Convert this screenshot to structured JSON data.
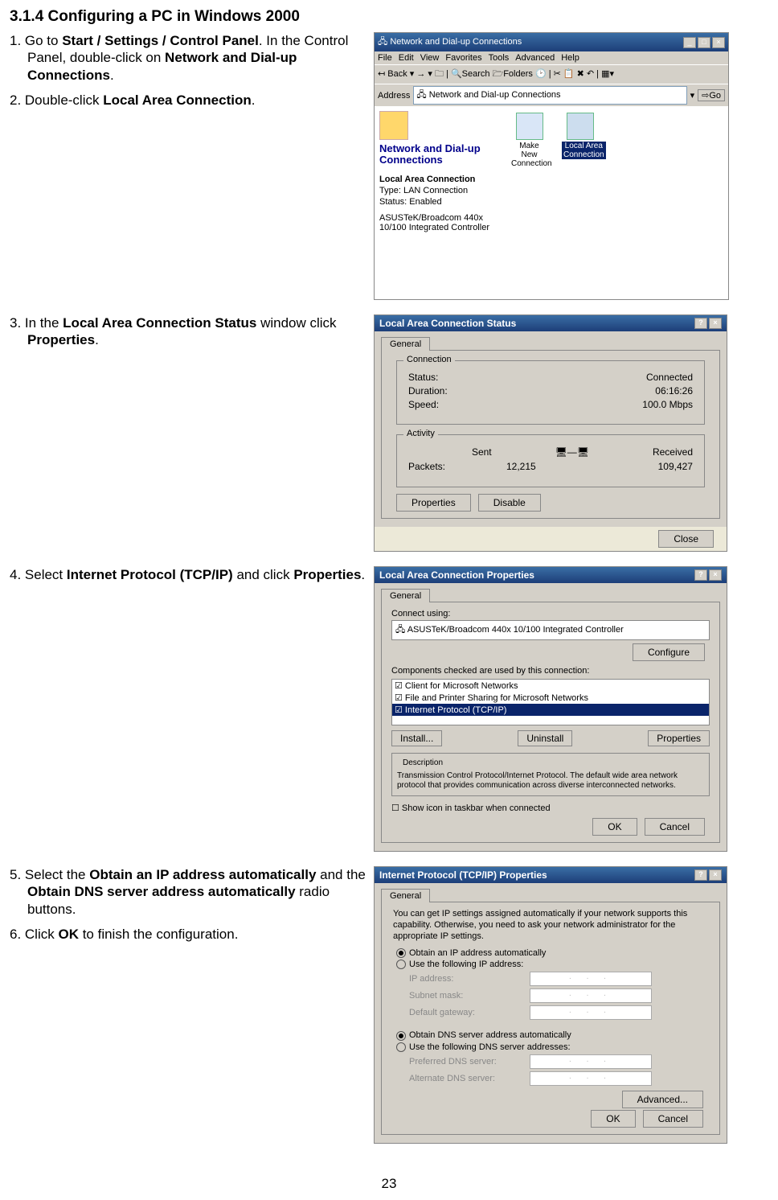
{
  "section_title": "3.1.4 Configuring a PC in Windows 2000",
  "page_number": "23",
  "steps": {
    "s1a": "1. Go to ",
    "s1b": "Start / Settings / Control Panel",
    "s1c": ". In the Control Panel, double-click on ",
    "s1d": "Network and Dial-up Connections",
    "s1e": ".",
    "s2a": "2. Double-click ",
    "s2b": "Local Area Connection",
    "s2c": ".",
    "s3a": "3. In the ",
    "s3b": "Local Area Connection Status",
    "s3c": " window click ",
    "s3d": "Properties",
    "s3e": ".",
    "s4a": "4. Select ",
    "s4b": "Internet Protocol (TCP/IP)",
    "s4c": " and click ",
    "s4d": "Properties",
    "s4e": ".",
    "s5a": "5. Select the ",
    "s5b": "Obtain an IP address automatically",
    "s5c": " and the ",
    "s5d": "Obtain DNS server address automatically",
    "s5e": " radio buttons.",
    "s6a": "6. Click ",
    "s6b": "OK",
    "s6c": " to finish the configuration."
  },
  "win1": {
    "title": "Network and Dial-up Connections",
    "menus": [
      "File",
      "Edit",
      "View",
      "Favorites",
      "Tools",
      "Advanced",
      "Help"
    ],
    "toolbar": "↤ Back ▾  →  ▾  🗀  | 🔍Search  🗁Folders  🕑 | ✂ 📋 ✖ ↶ | ▦▾",
    "address_label": "Address",
    "address_value": "Network and Dial-up Connections",
    "go": "Go",
    "left_title": "Network and Dial-up Connections",
    "lac": "Local Area Connection",
    "type_label": "Type: LAN Connection",
    "status_label": "Status: Enabled",
    "adapter": "ASUSTeK/Broadcom 440x 10/100 Integrated Controller",
    "icon1": "Make New Connection",
    "icon2": "Local Area Connection"
  },
  "win2": {
    "title": "Local Area Connection Status",
    "tab": "General",
    "grp1": "Connection",
    "status_l": "Status:",
    "status_v": "Connected",
    "dur_l": "Duration:",
    "dur_v": "06:16:26",
    "speed_l": "Speed:",
    "speed_v": "100.0 Mbps",
    "grp2": "Activity",
    "sent": "Sent",
    "recv": "Received",
    "packets_l": "Packets:",
    "packets_sent": "12,215",
    "packets_recv": "109,427",
    "btn_props": "Properties",
    "btn_disable": "Disable",
    "btn_close": "Close"
  },
  "win3": {
    "title": "Local Area Connection Properties",
    "tab": "General",
    "connect_using_l": "Connect using:",
    "adapter": "ASUSTeK/Broadcom 440x 10/100 Integrated Controller",
    "configure": "Configure",
    "components_l": "Components checked are used by this connection:",
    "items": [
      "Client for Microsoft Networks",
      "File and Printer Sharing for Microsoft Networks",
      "Internet Protocol (TCP/IP)"
    ],
    "install": "Install...",
    "uninstall": "Uninstall",
    "properties": "Properties",
    "desc_l": "Description",
    "desc": "Transmission Control Protocol/Internet Protocol. The default wide area network protocol that provides communication across diverse interconnected networks.",
    "showicon": "Show icon in taskbar when connected",
    "ok": "OK",
    "cancel": "Cancel"
  },
  "win4": {
    "title": "Internet Protocol (TCP/IP) Properties",
    "tab": "General",
    "intro": "You can get IP settings assigned automatically if your network supports this capability. Otherwise, you need to ask your network administrator for the appropriate IP settings.",
    "r1": "Obtain an IP address automatically",
    "r2": "Use the following IP address:",
    "ip_l": "IP address:",
    "mask_l": "Subnet mask:",
    "gw_l": "Default gateway:",
    "r3": "Obtain DNS server address automatically",
    "r4": "Use the following DNS server addresses:",
    "pdns_l": "Preferred DNS server:",
    "adns_l": "Alternate DNS server:",
    "dots": ".   .   .",
    "advanced": "Advanced...",
    "ok": "OK",
    "cancel": "Cancel"
  }
}
